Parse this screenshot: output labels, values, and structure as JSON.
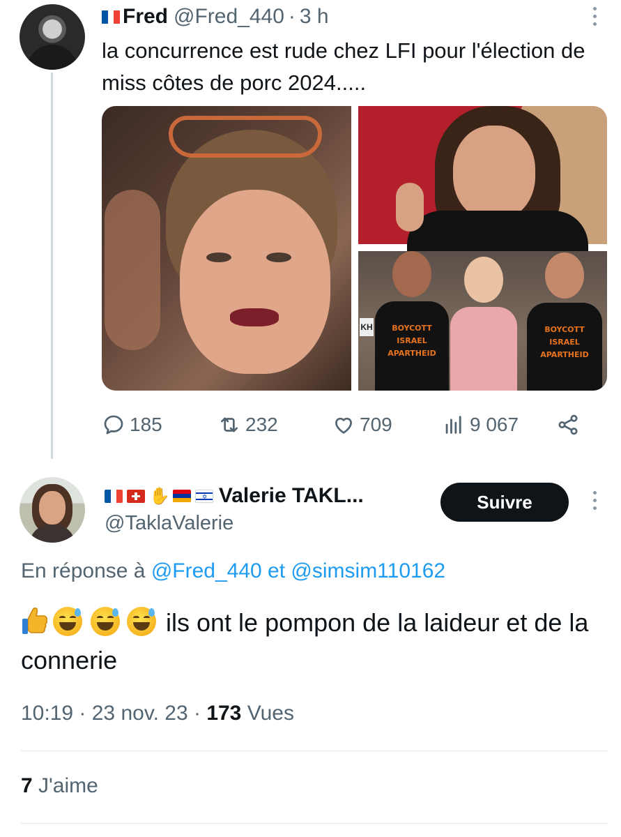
{
  "parent_tweet": {
    "display_name": "Fred",
    "handle": "@Fred_440",
    "time": "3 h",
    "separator": "·",
    "text": "la concurrence est rude chez LFI pour l'élection de miss côtes de porc 2024.....",
    "media_text": [
      "BOYCOTT",
      "ISRAEL",
      "APARTHEID"
    ],
    "media_text_right": [
      "BOYCOTT",
      "ISRAEL",
      "APARTHEID"
    ],
    "media_sign": "KH",
    "stats": {
      "replies": "185",
      "retweets": "232",
      "likes": "709",
      "views": "9 067"
    }
  },
  "reply_tweet": {
    "display_name": "Valerie TAKL...",
    "handle": "@TaklaValerie",
    "follow_label": "Suivre",
    "reply_to_prefix": "En réponse à",
    "reply_to_user1": "@Fred_440",
    "reply_to_and": "et",
    "reply_to_user2": "@simsim110162",
    "emojis": [
      "thumbs-up",
      "grinning-sweat",
      "grinning-sweat",
      "grinning-sweat"
    ],
    "text": "ils ont le pompon de la laideur et de la connerie",
    "time": "10:19",
    "date": "23 nov. 23",
    "views_count": "173",
    "views_label": "Vues",
    "likes_count": "7",
    "likes_label": "J'aime"
  },
  "colors": {
    "text": "#0f1419",
    "secondary": "#536471",
    "link": "#1d9bf0",
    "thread_line": "#cfd9de",
    "button_bg": "#0f1419"
  }
}
